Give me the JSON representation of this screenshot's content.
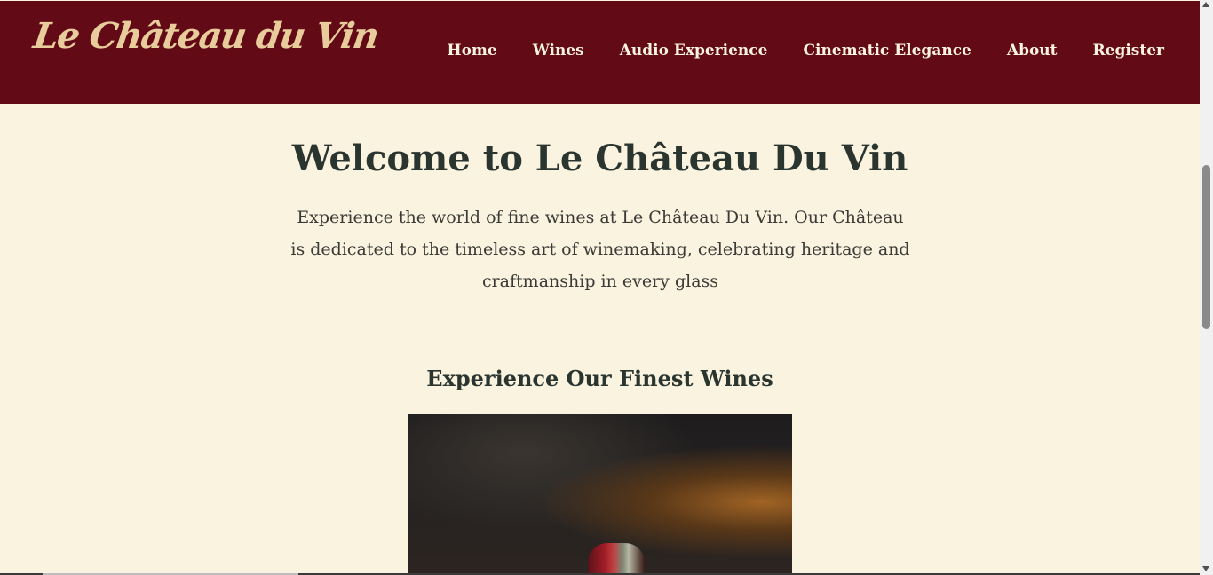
{
  "brand": {
    "logo_text": "Le Château du Vin",
    "colors": {
      "navbar_bg": "#620a16",
      "logo": "#e9cc9c",
      "page_bg": "#faf3e0",
      "heading": "#2b3530"
    }
  },
  "nav": {
    "items": [
      {
        "label": "Home"
      },
      {
        "label": "Wines"
      },
      {
        "label": "Audio Experience"
      },
      {
        "label": "Cinematic Elegance"
      },
      {
        "label": "About"
      },
      {
        "label": "Register"
      }
    ]
  },
  "hero": {
    "title": "Welcome to Le Château Du Vin",
    "intro": "Experience the world of fine wines at Le Château Du Vin. Our Château is dedicated to the timeless art of winemaking, celebrating heritage and craftmanship in every glass"
  },
  "featured": {
    "title": "Experience Our Finest Wines",
    "image_icon": "wine-bottle-photo"
  }
}
